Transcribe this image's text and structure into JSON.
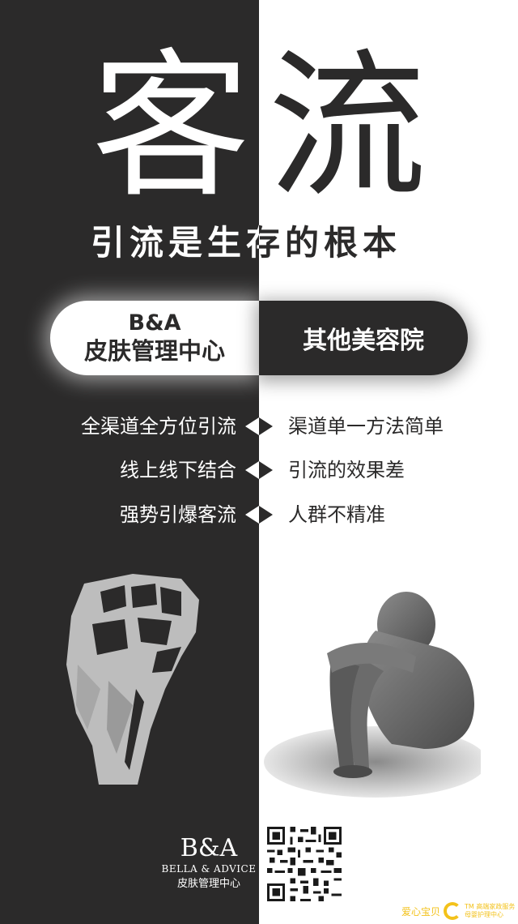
{
  "title": {
    "left_char": "客",
    "right_char": "流"
  },
  "subtitle": "引流是生存的根本",
  "comparison": {
    "left_line1": "B&A",
    "left_line2": "皮肤管理中心",
    "right_label": "其他美容院"
  },
  "rows": [
    {
      "left": "全渠道全方位引流",
      "right": "渠道单一方法简单"
    },
    {
      "left": "线上线下结合",
      "right": "引流的效果差"
    },
    {
      "left": "强势引爆客流",
      "right": "人群不精准"
    }
  ],
  "footer": {
    "logo": "B&A",
    "brand_en": "BELLA & ADVICE",
    "brand_cn": "皮肤管理中心"
  },
  "watermark": {
    "name": "爱心宝贝",
    "tagline": "母婴护理中心",
    "small_text": "TM 高端家政服务"
  },
  "colors": {
    "dark": "#2b2a2a",
    "light": "#ffffff",
    "accent": "#f3c21b"
  },
  "icons": [
    "fist-icon",
    "sad-person-icon",
    "qr-code",
    "diamond-bullet-icon"
  ]
}
